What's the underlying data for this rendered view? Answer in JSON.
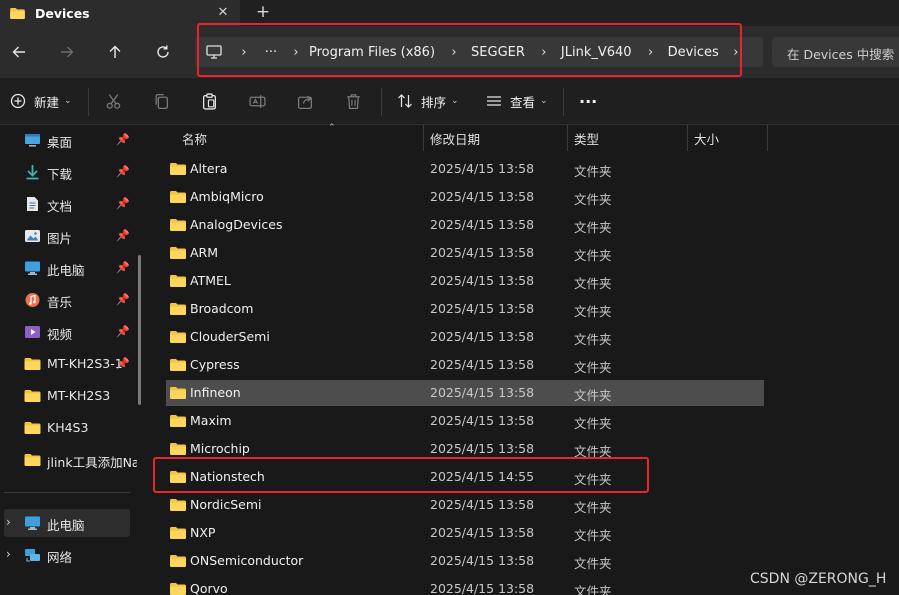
{
  "window": {
    "tab_title": "Devices",
    "close_symbol": "✕",
    "new_tab_symbol": "+"
  },
  "nav": {
    "back_icon": "arrow-left-icon",
    "forward_icon": "arrow-right-icon",
    "up_icon": "arrow-up-icon",
    "refresh_icon": "refresh-icon",
    "more_crumbs": "···",
    "breadcrumbs": [
      "Program Files (x86)",
      "SEGGER",
      "JLink_V640",
      "Devices"
    ],
    "search_placeholder": "在 Devices 中搜索"
  },
  "toolbar": {
    "new_label": "新建",
    "sort_label": "排序",
    "view_label": "查看",
    "more_label": "···"
  },
  "sidebar": {
    "quick": [
      {
        "label": "桌面",
        "icon": "desktop-icon"
      },
      {
        "label": "下载",
        "icon": "download-icon"
      },
      {
        "label": "文档",
        "icon": "documents-icon"
      },
      {
        "label": "图片",
        "icon": "pictures-icon"
      },
      {
        "label": "此电脑",
        "icon": "this-pc-icon"
      },
      {
        "label": "音乐",
        "icon": "music-icon"
      },
      {
        "label": "视频",
        "icon": "video-icon"
      },
      {
        "label": "MT-KH2S3-1",
        "icon": "folder-icon"
      },
      {
        "label": "MT-KH2S3",
        "icon": "folder-icon"
      },
      {
        "label": "KH4S3",
        "icon": "folder-icon"
      },
      {
        "label": "jlink工具添加Nations",
        "icon": "folder-icon"
      }
    ],
    "tree": [
      {
        "label": "此电脑",
        "icon": "this-pc-icon"
      },
      {
        "label": "网络",
        "icon": "network-icon"
      }
    ]
  },
  "filelist": {
    "columns": {
      "name": "名称",
      "date": "修改日期",
      "type": "类型",
      "size": "大小"
    },
    "rows": [
      {
        "name": "Altera",
        "date": "2025/4/15 13:58",
        "type": "文件夹"
      },
      {
        "name": "AmbiqMicro",
        "date": "2025/4/15 13:58",
        "type": "文件夹"
      },
      {
        "name": "AnalogDevices",
        "date": "2025/4/15 13:58",
        "type": "文件夹"
      },
      {
        "name": "ARM",
        "date": "2025/4/15 13:58",
        "type": "文件夹"
      },
      {
        "name": "ATMEL",
        "date": "2025/4/15 13:58",
        "type": "文件夹"
      },
      {
        "name": "Broadcom",
        "date": "2025/4/15 13:58",
        "type": "文件夹"
      },
      {
        "name": "ClouderSemi",
        "date": "2025/4/15 13:58",
        "type": "文件夹"
      },
      {
        "name": "Cypress",
        "date": "2025/4/15 13:58",
        "type": "文件夹"
      },
      {
        "name": "Infineon",
        "date": "2025/4/15 13:58",
        "type": "文件夹"
      },
      {
        "name": "Maxim",
        "date": "2025/4/15 13:58",
        "type": "文件夹"
      },
      {
        "name": "Microchip",
        "date": "2025/4/15 13:58",
        "type": "文件夹"
      },
      {
        "name": "Nationstech",
        "date": "2025/4/15 14:55",
        "type": "文件夹"
      },
      {
        "name": "NordicSemi",
        "date": "2025/4/15 13:58",
        "type": "文件夹"
      },
      {
        "name": "NXP",
        "date": "2025/4/15 13:58",
        "type": "文件夹"
      },
      {
        "name": "ONSemiconductor",
        "date": "2025/4/15 13:58",
        "type": "文件夹"
      },
      {
        "name": "Qorvo",
        "date": "2025/4/15 13:58",
        "type": "文件夹"
      }
    ]
  },
  "watermark": "CSDN @ZERONG_H",
  "colors": {
    "highlight_box": "#e8262a",
    "folder": "#f4c443",
    "selected_row": "#4d4d4d"
  }
}
